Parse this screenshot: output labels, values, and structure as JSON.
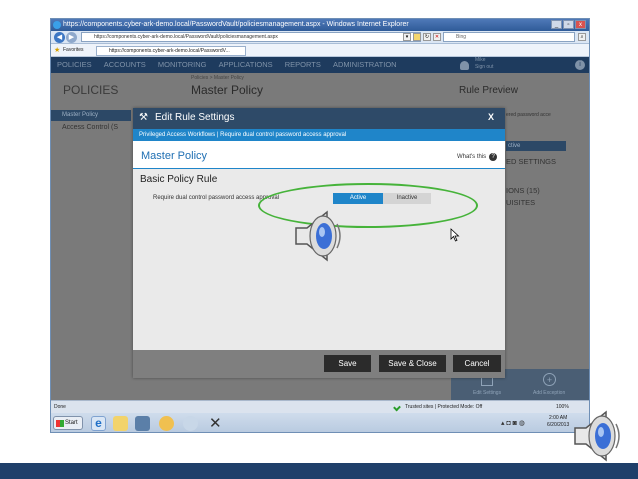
{
  "browser": {
    "title": "https://components.cyber-ark-demo.local/PasswordVault/policiesmanagement.aspx - Windows Internet Explorer",
    "address": "https://components.cyber-ark-demo.local/PasswordVault/policiesmanagement.aspx",
    "search_placeholder": "Bing",
    "favorites_label": "Favorites",
    "tab_label": "https://components.cyber-ark-demo.local/PasswordV...",
    "status_left": "Done",
    "status_zone": "Trusted sites | Protected Mode: Off",
    "zoom": "100%"
  },
  "app_nav": {
    "items": [
      "POLICIES",
      "ACCOUNTS",
      "MONITORING",
      "APPLICATIONS",
      "REPORTS",
      "ADMINISTRATION"
    ],
    "user_name": "Mike",
    "user_action": "Sign out"
  },
  "background": {
    "page_title": "POLICIES",
    "breadcrumb": "Policies > Master Policy",
    "policy_title": "Master Policy",
    "left_item_1": "Master Policy",
    "left_item_2": "Access Control (S",
    "right_title": "Rule Preview",
    "right_hint": "ered password acce",
    "right_active": "ctive",
    "right_settings": "ED SETTINGS",
    "right_exceptions": "IONS (15)",
    "right_requisites": "UISITES",
    "bottom_btn_1": "Edit Settings",
    "bottom_btn_2": "Add Exception"
  },
  "modal": {
    "title": "Edit Rule Settings",
    "close": "X",
    "subtitle": "Privileged Access Workflows | Require dual control password access approval",
    "policy_name": "Master Policy",
    "whats_this": "What's this",
    "section_title": "Basic Policy Rule",
    "rule_label": "Require dual control password access approval",
    "toggle_active": "Active",
    "toggle_inactive": "Inactive",
    "save": "Save",
    "save_close": "Save & Close",
    "cancel": "Cancel"
  },
  "taskbar": {
    "start": "Start",
    "time": "2:00 AM",
    "date": "6/20/2013"
  },
  "colors": {
    "accent_blue": "#1f85c9",
    "modal_header": "#2e4a68",
    "highlight_ellipse": "#46b33a"
  }
}
